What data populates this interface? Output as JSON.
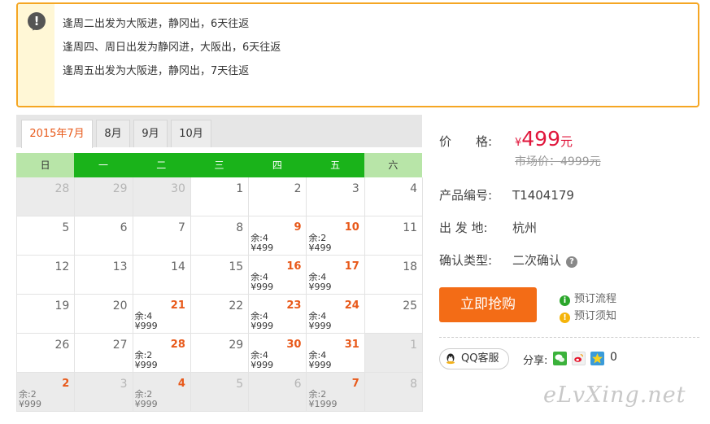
{
  "notice": {
    "lines": [
      "逢周二出发为大阪进，静冈出，6天往返",
      "逢周四、周日出发为静冈进，大阪出，6天往返",
      "逢周五出发为大阪进，静冈出，7天往返"
    ]
  },
  "tabs": [
    "2015年7月",
    "8月",
    "9月",
    "10月"
  ],
  "calendar": {
    "weekdays": [
      "日",
      "一",
      "二",
      "三",
      "四",
      "五",
      "六"
    ],
    "weeks": [
      [
        {
          "d": "28",
          "g": true
        },
        {
          "d": "29",
          "g": true
        },
        {
          "d": "30",
          "g": true
        },
        {
          "d": "1"
        },
        {
          "d": "2"
        },
        {
          "d": "3"
        },
        {
          "d": "4"
        }
      ],
      [
        {
          "d": "5"
        },
        {
          "d": "6"
        },
        {
          "d": "7"
        },
        {
          "d": "8"
        },
        {
          "d": "9",
          "s": "余:4",
          "p": "¥499"
        },
        {
          "d": "10",
          "s": "余:2",
          "p": "¥499"
        },
        {
          "d": "11"
        }
      ],
      [
        {
          "d": "12"
        },
        {
          "d": "13"
        },
        {
          "d": "14"
        },
        {
          "d": "15"
        },
        {
          "d": "16",
          "s": "余:4",
          "p": "¥999"
        },
        {
          "d": "17",
          "s": "余:4",
          "p": "¥999"
        },
        {
          "d": "18"
        }
      ],
      [
        {
          "d": "19"
        },
        {
          "d": "20"
        },
        {
          "d": "21",
          "s": "余:4",
          "p": "¥999"
        },
        {
          "d": "22"
        },
        {
          "d": "23",
          "s": "余:4",
          "p": "¥999"
        },
        {
          "d": "24",
          "s": "余:4",
          "p": "¥999"
        },
        {
          "d": "25"
        }
      ],
      [
        {
          "d": "26"
        },
        {
          "d": "27"
        },
        {
          "d": "28",
          "s": "余:2",
          "p": "¥999"
        },
        {
          "d": "29"
        },
        {
          "d": "30",
          "s": "余:4",
          "p": "¥999"
        },
        {
          "d": "31",
          "s": "余:4",
          "p": "¥999"
        },
        {
          "d": "1",
          "g": true
        }
      ],
      [
        {
          "d": "2",
          "g": true,
          "s": "余:2",
          "p": "¥999"
        },
        {
          "d": "3",
          "g": true
        },
        {
          "d": "4",
          "g": true,
          "s": "余:2",
          "p": "¥999"
        },
        {
          "d": "5",
          "g": true
        },
        {
          "d": "6",
          "g": true
        },
        {
          "d": "7",
          "g": true,
          "s": "余:2",
          "p": "¥1999"
        },
        {
          "d": "8",
          "g": true
        }
      ]
    ]
  },
  "info": {
    "price_label": "价　　格:",
    "price_currency": "¥",
    "price_amount": "499",
    "price_unit": "元",
    "market_price": "市场价：4999元",
    "code_label": "产品编号:",
    "code_value": "T1404179",
    "origin_label": "出 发 地:",
    "origin_value": "杭州",
    "confirm_label": "确认类型:",
    "confirm_value": "二次确认"
  },
  "buttons": {
    "buy": "立即抢购",
    "booking_flow": "预订流程",
    "booking_notice": "预订须知",
    "qq_service": "QQ客服"
  },
  "share": {
    "label": "分享:",
    "count": "0"
  },
  "watermark": "eLvXing.net",
  "colors": {
    "accent_orange": "#f36c16",
    "price_red": "#e0173c",
    "calendar_green": "#1ab31a",
    "notice_border": "#f5a623"
  }
}
